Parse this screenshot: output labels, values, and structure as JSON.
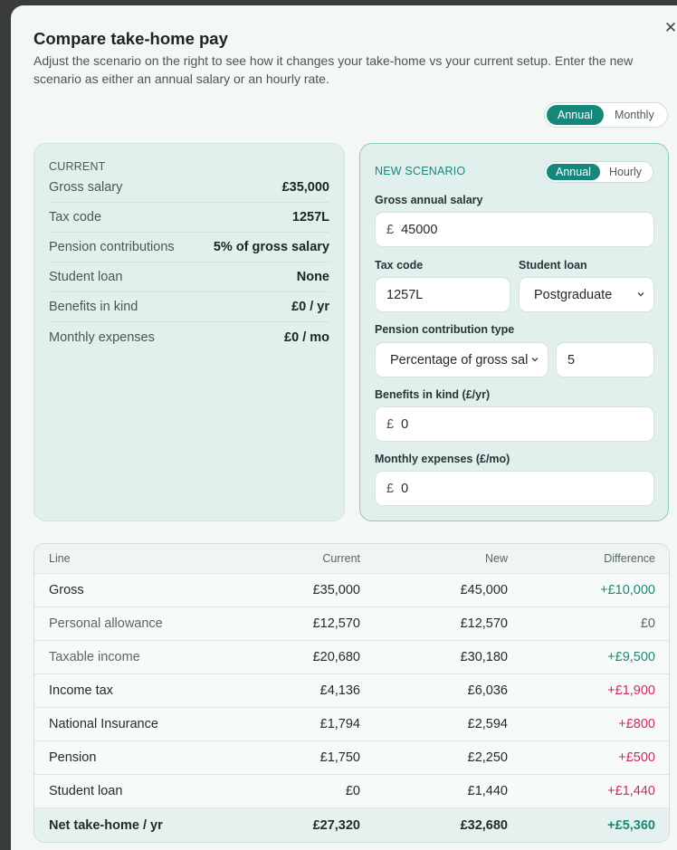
{
  "modal": {
    "title": "Compare take-home pay",
    "subtitle": "Adjust the scenario on the right to see how it changes your take-home vs your current setup. Enter the new scenario as either an annual salary or an hourly rate."
  },
  "period_toggle": {
    "options": [
      "Annual",
      "Monthly"
    ],
    "selected": "Annual"
  },
  "current": {
    "heading": "CURRENT",
    "rows": [
      {
        "label": "Gross salary",
        "value": "£35,000"
      },
      {
        "label": "Tax code",
        "value": "1257L"
      },
      {
        "label": "Pension contributions",
        "value": "5% of gross salary"
      },
      {
        "label": "Student loan",
        "value": "None"
      },
      {
        "label": "Benefits in kind",
        "value": "£0 / yr"
      },
      {
        "label": "Monthly expenses",
        "value": "£0 / mo"
      }
    ]
  },
  "new_scenario": {
    "heading": "NEW SCENARIO",
    "mode_toggle": {
      "options": [
        "Annual",
        "Hourly"
      ],
      "selected": "Annual"
    },
    "currency_symbol": "£",
    "gross_label": "Gross annual salary",
    "gross_value": "45000",
    "tax_code_label": "Tax code",
    "tax_code_value": "1257L",
    "student_loan_label": "Student loan",
    "student_loan_value": "Postgraduate",
    "pension_type_label": "Pension contribution type",
    "pension_type_value": "Percentage of gross salary",
    "pension_amount_value": "5",
    "benefits_label": "Benefits in kind (£/yr)",
    "benefits_value": "0",
    "expenses_label": "Monthly expenses (£/mo)",
    "expenses_value": "0"
  },
  "table": {
    "headers": [
      "Line",
      "Current",
      "New",
      "Difference"
    ],
    "rows": [
      {
        "line": "Gross",
        "current": "£35,000",
        "new": "£45,000",
        "diff": "+£10,000",
        "diff_tone": "pos",
        "muted": false
      },
      {
        "line": "Personal allowance",
        "current": "£12,570",
        "new": "£12,570",
        "diff": "£0",
        "diff_tone": "zero",
        "muted": true
      },
      {
        "line": "Taxable income",
        "current": "£20,680",
        "new": "£30,180",
        "diff": "+£9,500",
        "diff_tone": "pos",
        "muted": true
      },
      {
        "line": "Income tax",
        "current": "£4,136",
        "new": "£6,036",
        "diff": "+£1,900",
        "diff_tone": "neg",
        "muted": false
      },
      {
        "line": "National Insurance",
        "current": "£1,794",
        "new": "£2,594",
        "diff": "+£800",
        "diff_tone": "neg",
        "muted": false
      },
      {
        "line": "Pension",
        "current": "£1,750",
        "new": "£2,250",
        "diff": "+£500",
        "diff_tone": "neg",
        "muted": false
      },
      {
        "line": "Student loan",
        "current": "£0",
        "new": "£1,440",
        "diff": "+£1,440",
        "diff_tone": "neg",
        "muted": false
      },
      {
        "line": "Net take-home / yr",
        "current": "£27,320",
        "new": "£32,680",
        "diff": "+£5,360",
        "diff_tone": "pos",
        "muted": false
      }
    ]
  },
  "colors": {
    "accent": "#16877b",
    "positive": "#1a8a74",
    "negative": "#cf2a59"
  }
}
